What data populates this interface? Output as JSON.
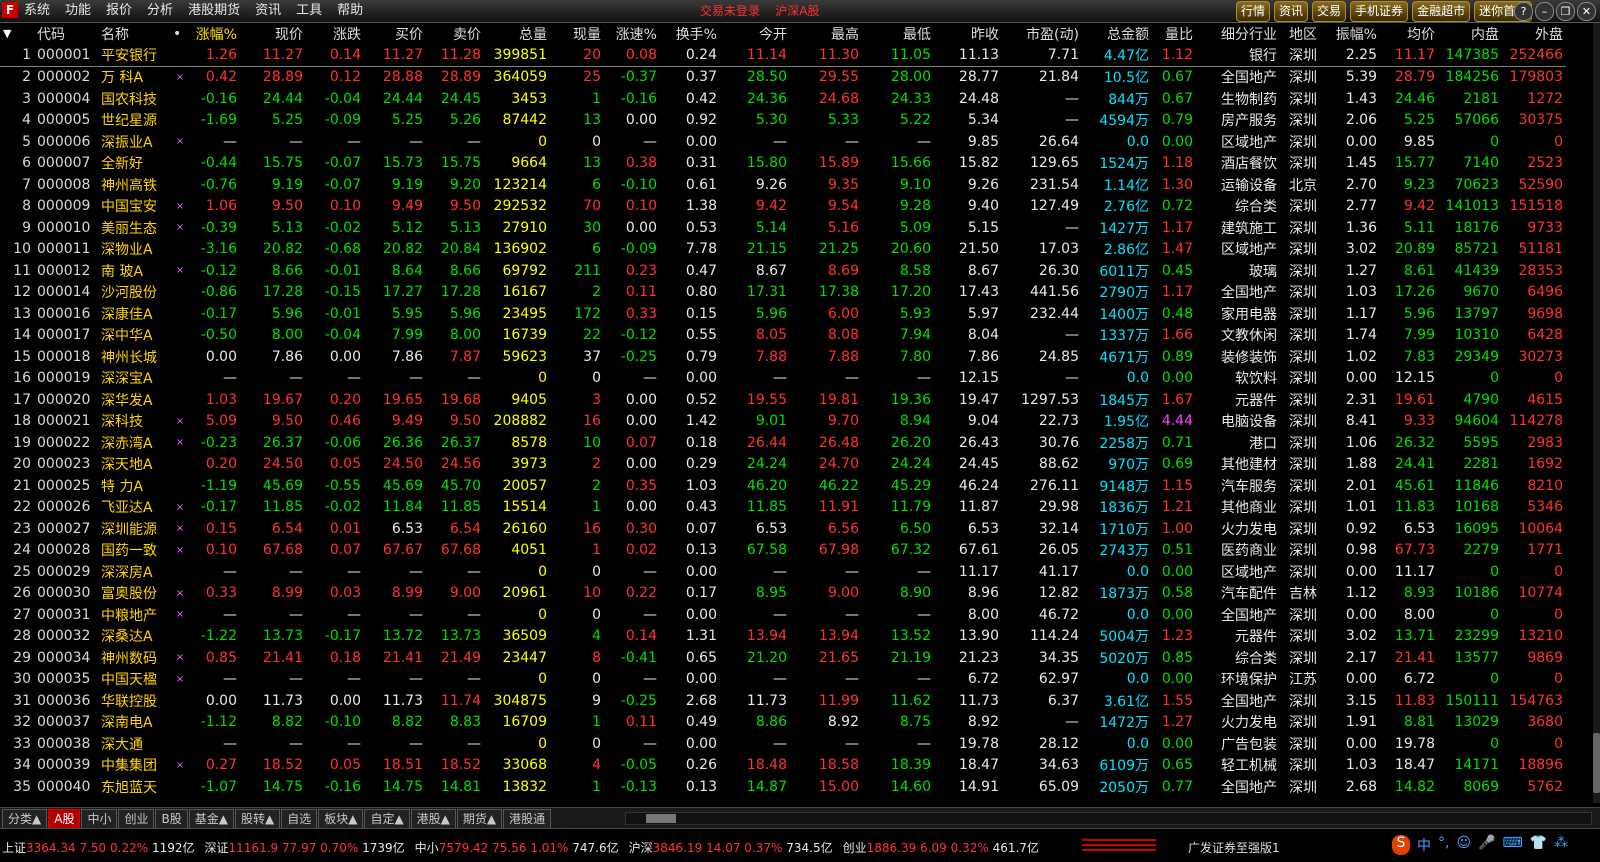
{
  "menubar": {
    "items": [
      "系统",
      "功能",
      "报价",
      "分析",
      "港股期货",
      "资讯",
      "工具",
      "帮助"
    ],
    "title_left": "交易未登录",
    "title_right": "沪深A股",
    "right_tabs": [
      "行情",
      "资讯",
      "交易",
      "手机证券",
      "金融超市",
      "迷你首页"
    ]
  },
  "columns": [
    "代码",
    "名称",
    "•",
    "涨幅%",
    "现价",
    "涨跌",
    "买价",
    "卖价",
    "总量",
    "现量",
    "涨速%",
    "换手%",
    "今开",
    "最高",
    "最低",
    "昨收",
    "市盈(动)",
    "总金额",
    "量比",
    "细分行业",
    "地区",
    "振幅%",
    "均价",
    "内盘",
    "外盘"
  ],
  "rows": [
    [
      "1",
      "000001",
      "平安银行",
      "",
      "1.26",
      "11.27",
      "0.14",
      "11.27",
      "11.28",
      "399851",
      "20",
      "0.08",
      "0.24",
      "11.14",
      "11.30",
      "11.05",
      "11.13",
      "7.71",
      "4.47亿",
      "1.12",
      "银行",
      "深圳",
      "2.25",
      "11.17",
      "147385",
      "252466"
    ],
    [
      "2",
      "000002",
      "万 科A",
      "×",
      "0.42",
      "28.89",
      "0.12",
      "28.88",
      "28.89",
      "364059",
      "25",
      "-0.37",
      "0.37",
      "28.50",
      "29.55",
      "28.00",
      "28.77",
      "21.84",
      "10.5亿",
      "0.67",
      "全国地产",
      "深圳",
      "5.39",
      "28.79",
      "184256",
      "179803"
    ],
    [
      "3",
      "000004",
      "国农科技",
      "",
      "-0.16",
      "24.44",
      "-0.04",
      "24.44",
      "24.45",
      "3453",
      "1",
      "-0.16",
      "0.42",
      "24.36",
      "24.68",
      "24.33",
      "24.48",
      "—",
      "844万",
      "0.67",
      "生物制药",
      "深圳",
      "1.43",
      "24.46",
      "2181",
      "1272"
    ],
    [
      "4",
      "000005",
      "世纪星源",
      "",
      "-1.69",
      "5.25",
      "-0.09",
      "5.25",
      "5.26",
      "87442",
      "13",
      "0.00",
      "0.92",
      "5.30",
      "5.33",
      "5.22",
      "5.34",
      "—",
      "4594万",
      "0.79",
      "房产服务",
      "深圳",
      "2.06",
      "5.25",
      "57066",
      "30375"
    ],
    [
      "5",
      "000006",
      "深振业A",
      "×",
      "—",
      "—",
      "—",
      "—",
      "—",
      "0",
      "0",
      "—",
      "0.00",
      "—",
      "—",
      "—",
      "9.85",
      "26.64",
      "0.0",
      "0.00",
      "区域地产",
      "深圳",
      "0.00",
      "9.85",
      "0",
      "0"
    ],
    [
      "6",
      "000007",
      "全新好",
      "",
      "-0.44",
      "15.75",
      "-0.07",
      "15.73",
      "15.75",
      "9664",
      "13",
      "0.38",
      "0.31",
      "15.80",
      "15.89",
      "15.66",
      "15.82",
      "129.65",
      "1524万",
      "1.18",
      "酒店餐饮",
      "深圳",
      "1.45",
      "15.77",
      "7140",
      "2523"
    ],
    [
      "7",
      "000008",
      "神州高铁",
      "",
      "-0.76",
      "9.19",
      "-0.07",
      "9.19",
      "9.20",
      "123214",
      "6",
      "-0.10",
      "0.61",
      "9.26",
      "9.35",
      "9.10",
      "9.26",
      "231.54",
      "1.14亿",
      "1.30",
      "运输设备",
      "北京",
      "2.70",
      "9.23",
      "70623",
      "52590"
    ],
    [
      "8",
      "000009",
      "中国宝安",
      "×",
      "1.06",
      "9.50",
      "0.10",
      "9.49",
      "9.50",
      "292532",
      "70",
      "0.10",
      "1.38",
      "9.42",
      "9.54",
      "9.28",
      "9.40",
      "127.49",
      "2.76亿",
      "0.72",
      "综合类",
      "深圳",
      "2.77",
      "9.42",
      "141013",
      "151518"
    ],
    [
      "9",
      "000010",
      "美丽生态",
      "×",
      "-0.39",
      "5.13",
      "-0.02",
      "5.12",
      "5.13",
      "27910",
      "30",
      "0.00",
      "0.53",
      "5.14",
      "5.16",
      "5.09",
      "5.15",
      "—",
      "1427万",
      "1.17",
      "建筑施工",
      "深圳",
      "1.36",
      "5.11",
      "18176",
      "9733"
    ],
    [
      "10",
      "000011",
      "深物业A",
      "",
      "-3.16",
      "20.82",
      "-0.68",
      "20.82",
      "20.84",
      "136902",
      "6",
      "-0.09",
      "7.78",
      "21.15",
      "21.25",
      "20.60",
      "21.50",
      "17.03",
      "2.86亿",
      "1.47",
      "区域地产",
      "深圳",
      "3.02",
      "20.89",
      "85721",
      "51181"
    ],
    [
      "11",
      "000012",
      "南 玻A",
      "×",
      "-0.12",
      "8.66",
      "-0.01",
      "8.64",
      "8.66",
      "69792",
      "211",
      "0.23",
      "0.47",
      "8.67",
      "8.69",
      "8.58",
      "8.67",
      "26.30",
      "6011万",
      "0.45",
      "玻璃",
      "深圳",
      "1.27",
      "8.61",
      "41439",
      "28353"
    ],
    [
      "12",
      "000014",
      "沙河股份",
      "",
      "-0.86",
      "17.28",
      "-0.15",
      "17.27",
      "17.28",
      "16167",
      "2",
      "0.11",
      "0.80",
      "17.31",
      "17.38",
      "17.20",
      "17.43",
      "441.56",
      "2790万",
      "1.17",
      "全国地产",
      "深圳",
      "1.03",
      "17.26",
      "9670",
      "6496"
    ],
    [
      "13",
      "000016",
      "深康佳A",
      "",
      "-0.17",
      "5.96",
      "-0.01",
      "5.95",
      "5.96",
      "23495",
      "172",
      "0.33",
      "0.15",
      "5.96",
      "6.00",
      "5.93",
      "5.97",
      "232.44",
      "1400万",
      "0.48",
      "家用电器",
      "深圳",
      "1.17",
      "5.96",
      "13797",
      "9698"
    ],
    [
      "14",
      "000017",
      "深中华A",
      "",
      "-0.50",
      "8.00",
      "-0.04",
      "7.99",
      "8.00",
      "16739",
      "22",
      "-0.12",
      "0.55",
      "8.05",
      "8.08",
      "7.94",
      "8.04",
      "—",
      "1337万",
      "1.66",
      "文教休闲",
      "深圳",
      "1.74",
      "7.99",
      "10310",
      "6428"
    ],
    [
      "15",
      "000018",
      "神州长城",
      "",
      "0.00",
      "7.86",
      "0.00",
      "7.86",
      "7.87",
      "59623",
      "37",
      "-0.25",
      "0.79",
      "7.88",
      "7.88",
      "7.80",
      "7.86",
      "24.85",
      "4671万",
      "0.89",
      "装修装饰",
      "深圳",
      "1.02",
      "7.83",
      "29349",
      "30273"
    ],
    [
      "16",
      "000019",
      "深深宝A",
      "",
      "—",
      "—",
      "—",
      "—",
      "—",
      "0",
      "0",
      "—",
      "0.00",
      "—",
      "—",
      "—",
      "12.15",
      "—",
      "0.0",
      "0.00",
      "软饮料",
      "深圳",
      "0.00",
      "12.15",
      "0",
      "0"
    ],
    [
      "17",
      "000020",
      "深华发A",
      "",
      "1.03",
      "19.67",
      "0.20",
      "19.65",
      "19.68",
      "9405",
      "3",
      "0.00",
      "0.52",
      "19.55",
      "19.81",
      "19.36",
      "19.47",
      "1297.53",
      "1845万",
      "1.67",
      "元器件",
      "深圳",
      "2.31",
      "19.61",
      "4790",
      "4615"
    ],
    [
      "18",
      "000021",
      "深科技",
      "×",
      "5.09",
      "9.50",
      "0.46",
      "9.49",
      "9.50",
      "208882",
      "16",
      "0.00",
      "1.42",
      "9.01",
      "9.70",
      "8.94",
      "9.04",
      "22.73",
      "1.95亿",
      "4.44",
      "电脑设备",
      "深圳",
      "8.41",
      "9.33",
      "94604",
      "114278"
    ],
    [
      "19",
      "000022",
      "深赤湾A",
      "×",
      "-0.23",
      "26.37",
      "-0.06",
      "26.36",
      "26.37",
      "8578",
      "10",
      "0.07",
      "0.18",
      "26.44",
      "26.48",
      "26.20",
      "26.43",
      "30.76",
      "2258万",
      "0.71",
      "港口",
      "深圳",
      "1.06",
      "26.32",
      "5595",
      "2983"
    ],
    [
      "20",
      "000023",
      "深天地A",
      "",
      "0.20",
      "24.50",
      "0.05",
      "24.50",
      "24.56",
      "3973",
      "2",
      "0.00",
      "0.29",
      "24.24",
      "24.70",
      "24.24",
      "24.45",
      "88.62",
      "970万",
      "0.69",
      "其他建材",
      "深圳",
      "1.88",
      "24.41",
      "2281",
      "1692"
    ],
    [
      "21",
      "000025",
      "特 力A",
      "",
      "-1.19",
      "45.69",
      "-0.55",
      "45.69",
      "45.70",
      "20057",
      "2",
      "0.35",
      "1.03",
      "46.20",
      "46.22",
      "45.29",
      "46.24",
      "276.11",
      "9148万",
      "1.15",
      "汽车服务",
      "深圳",
      "2.01",
      "45.61",
      "11846",
      "8210"
    ],
    [
      "22",
      "000026",
      "飞亚达A",
      "×",
      "-0.17",
      "11.85",
      "-0.02",
      "11.84",
      "11.85",
      "15514",
      "1",
      "0.00",
      "0.43",
      "11.85",
      "11.91",
      "11.79",
      "11.87",
      "29.98",
      "1836万",
      "1.21",
      "其他商业",
      "深圳",
      "1.01",
      "11.83",
      "10168",
      "5346"
    ],
    [
      "23",
      "000027",
      "深圳能源",
      "×",
      "0.15",
      "6.54",
      "0.01",
      "6.53",
      "6.54",
      "26160",
      "16",
      "0.30",
      "0.07",
      "6.53",
      "6.56",
      "6.50",
      "6.53",
      "32.14",
      "1710万",
      "1.00",
      "火力发电",
      "深圳",
      "0.92",
      "6.53",
      "16095",
      "10064"
    ],
    [
      "24",
      "000028",
      "国药一致",
      "×",
      "0.10",
      "67.68",
      "0.07",
      "67.67",
      "67.68",
      "4051",
      "1",
      "0.02",
      "0.13",
      "67.58",
      "67.98",
      "67.32",
      "67.61",
      "26.05",
      "2743万",
      "0.51",
      "医药商业",
      "深圳",
      "0.98",
      "67.73",
      "2279",
      "1771"
    ],
    [
      "25",
      "000029",
      "深深房A",
      "",
      "—",
      "—",
      "—",
      "—",
      "—",
      "0",
      "0",
      "—",
      "0.00",
      "—",
      "—",
      "—",
      "11.17",
      "41.17",
      "0.0",
      "0.00",
      "区域地产",
      "深圳",
      "0.00",
      "11.17",
      "0",
      "0"
    ],
    [
      "26",
      "000030",
      "富奥股份",
      "×",
      "0.33",
      "8.99",
      "0.03",
      "8.99",
      "9.00",
      "20961",
      "10",
      "0.22",
      "0.17",
      "8.95",
      "9.00",
      "8.90",
      "8.96",
      "12.82",
      "1873万",
      "0.58",
      "汽车配件",
      "吉林",
      "1.12",
      "8.93",
      "10186",
      "10774"
    ],
    [
      "27",
      "000031",
      "中粮地产",
      "×",
      "—",
      "—",
      "—",
      "—",
      "—",
      "0",
      "0",
      "—",
      "0.00",
      "—",
      "—",
      "—",
      "8.00",
      "46.72",
      "0.0",
      "0.00",
      "全国地产",
      "深圳",
      "0.00",
      "8.00",
      "0",
      "0"
    ],
    [
      "28",
      "000032",
      "深桑达A",
      "",
      "-1.22",
      "13.73",
      "-0.17",
      "13.72",
      "13.73",
      "36509",
      "4",
      "0.14",
      "1.31",
      "13.94",
      "13.94",
      "13.52",
      "13.90",
      "114.24",
      "5004万",
      "1.23",
      "元器件",
      "深圳",
      "3.02",
      "13.71",
      "23299",
      "13210"
    ],
    [
      "29",
      "000034",
      "神州数码",
      "×",
      "0.85",
      "21.41",
      "0.18",
      "21.41",
      "21.49",
      "23447",
      "8",
      "-0.41",
      "0.65",
      "21.20",
      "21.65",
      "21.19",
      "21.23",
      "34.35",
      "5020万",
      "0.85",
      "综合类",
      "深圳",
      "2.17",
      "21.41",
      "13577",
      "9869"
    ],
    [
      "30",
      "000035",
      "中国天楹",
      "×",
      "—",
      "—",
      "—",
      "—",
      "—",
      "0",
      "0",
      "—",
      "0.00",
      "—",
      "—",
      "—",
      "6.72",
      "62.97",
      "0.0",
      "0.00",
      "环境保护",
      "江苏",
      "0.00",
      "6.72",
      "0",
      "0"
    ],
    [
      "31",
      "000036",
      "华联控股",
      "",
      "0.00",
      "11.73",
      "0.00",
      "11.73",
      "11.74",
      "304875",
      "9",
      "-0.25",
      "2.68",
      "11.73",
      "11.99",
      "11.62",
      "11.73",
      "6.37",
      "3.61亿",
      "1.55",
      "全国地产",
      "深圳",
      "3.15",
      "11.83",
      "150111",
      "154763"
    ],
    [
      "32",
      "000037",
      "深南电A",
      "",
      "-1.12",
      "8.82",
      "-0.10",
      "8.82",
      "8.83",
      "16709",
      "1",
      "0.11",
      "0.49",
      "8.86",
      "8.92",
      "8.75",
      "8.92",
      "—",
      "1472万",
      "1.27",
      "火力发电",
      "深圳",
      "1.91",
      "8.81",
      "13029",
      "3680"
    ],
    [
      "33",
      "000038",
      "深大通",
      "",
      "—",
      "—",
      "—",
      "—",
      "—",
      "0",
      "0",
      "—",
      "0.00",
      "—",
      "—",
      "—",
      "19.78",
      "28.12",
      "0.0",
      "0.00",
      "广告包装",
      "深圳",
      "0.00",
      "19.78",
      "0",
      "0"
    ],
    [
      "34",
      "000039",
      "中集集团",
      "×",
      "0.27",
      "18.52",
      "0.05",
      "18.51",
      "18.52",
      "33068",
      "4",
      "-0.05",
      "0.26",
      "18.48",
      "18.58",
      "18.39",
      "18.47",
      "34.63",
      "6109万",
      "0.65",
      "轻工机械",
      "深圳",
      "1.03",
      "18.47",
      "14171",
      "18896"
    ],
    [
      "35",
      "000040",
      "东旭蓝天",
      "",
      "-1.07",
      "14.75",
      "-0.16",
      "14.75",
      "14.81",
      "13832",
      "1",
      "-0.13",
      "0.13",
      "14.87",
      "15.00",
      "14.60",
      "14.91",
      "65.09",
      "2050万",
      "0.77",
      "全国地产",
      "深圳",
      "2.68",
      "14.82",
      "8069",
      "5762"
    ]
  ],
  "tabs": [
    "分类▲",
    "A股",
    "中小",
    "创业",
    "B股",
    "基金▲",
    "股转▲",
    "自选",
    "板块▲",
    "自定▲",
    "港股▲",
    "期货▲",
    "港股通"
  ],
  "status": [
    {
      "name": "上证",
      "idx": "3364.34",
      "chg": "7.50",
      "pct": "0.22%",
      "amt": "1192亿"
    },
    {
      "name": "深证",
      "idx": "11161.9",
      "chg": "77.97",
      "pct": "0.70%",
      "amt": "1739亿"
    },
    {
      "name": "中小",
      "idx": "7579.42",
      "chg": "75.56",
      "pct": "1.01%",
      "amt": "747.6亿"
    },
    {
      "name": "沪深",
      "idx": "3846.19",
      "chg": "14.07",
      "pct": "0.37%",
      "amt": "734.5亿"
    },
    {
      "name": "创业",
      "idx": "1886.39",
      "chg": "6.09",
      "pct": "0.32%",
      "amt": "461.7亿"
    }
  ],
  "broker": "广发证券至强版1",
  "tray": [
    "S",
    "中",
    "°,",
    "☺",
    "🎤",
    "⌨",
    "👕",
    "⁂"
  ],
  "colors": {
    "up": "#ff3232",
    "down": "#00e000",
    "flat": "#e8e8e8",
    "name": "#ffd400",
    "volume": "#ffff00",
    "amount": "#00e5ff"
  }
}
